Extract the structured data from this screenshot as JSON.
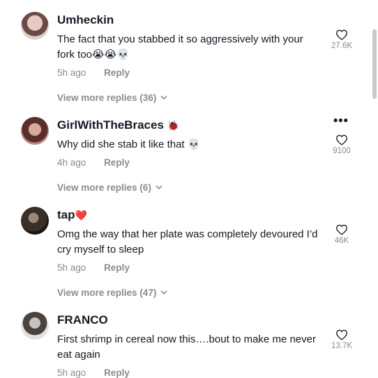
{
  "comments": [
    {
      "username": "Umheckin",
      "username_badge": "",
      "text": "The fact that you stabbed it so aggressively with your fork too😭😭💀",
      "time": "5h ago",
      "reply": "Reply",
      "replies": "View more replies (36)",
      "likes": "27.6K"
    },
    {
      "username": "GirlWithTheBraces",
      "username_badge": "🐞",
      "text": "Why did she stab it like that 💀",
      "time": "4h ago",
      "reply": "Reply",
      "replies": "View more replies (6)",
      "likes": "9100"
    },
    {
      "username": "tap",
      "username_badge": "❤️",
      "text": "Omg the way that her plate was completely devoured I’d cry myself to sleep",
      "time": "5h ago",
      "reply": "Reply",
      "replies": "View more replies (47)",
      "likes": "46K"
    },
    {
      "username": "FRANCO",
      "username_badge": "",
      "text": "First shrimp in cereal now this….bout to make me never eat again",
      "time": "5h ago",
      "reply": "Reply",
      "replies": "",
      "likes": "13.7K"
    }
  ],
  "icons": {
    "like": "heart-outline-icon",
    "more": "more-options-icon",
    "expand": "chevron-down-icon"
  },
  "colors": {
    "text": "#161823",
    "muted": "#8a8b91"
  }
}
